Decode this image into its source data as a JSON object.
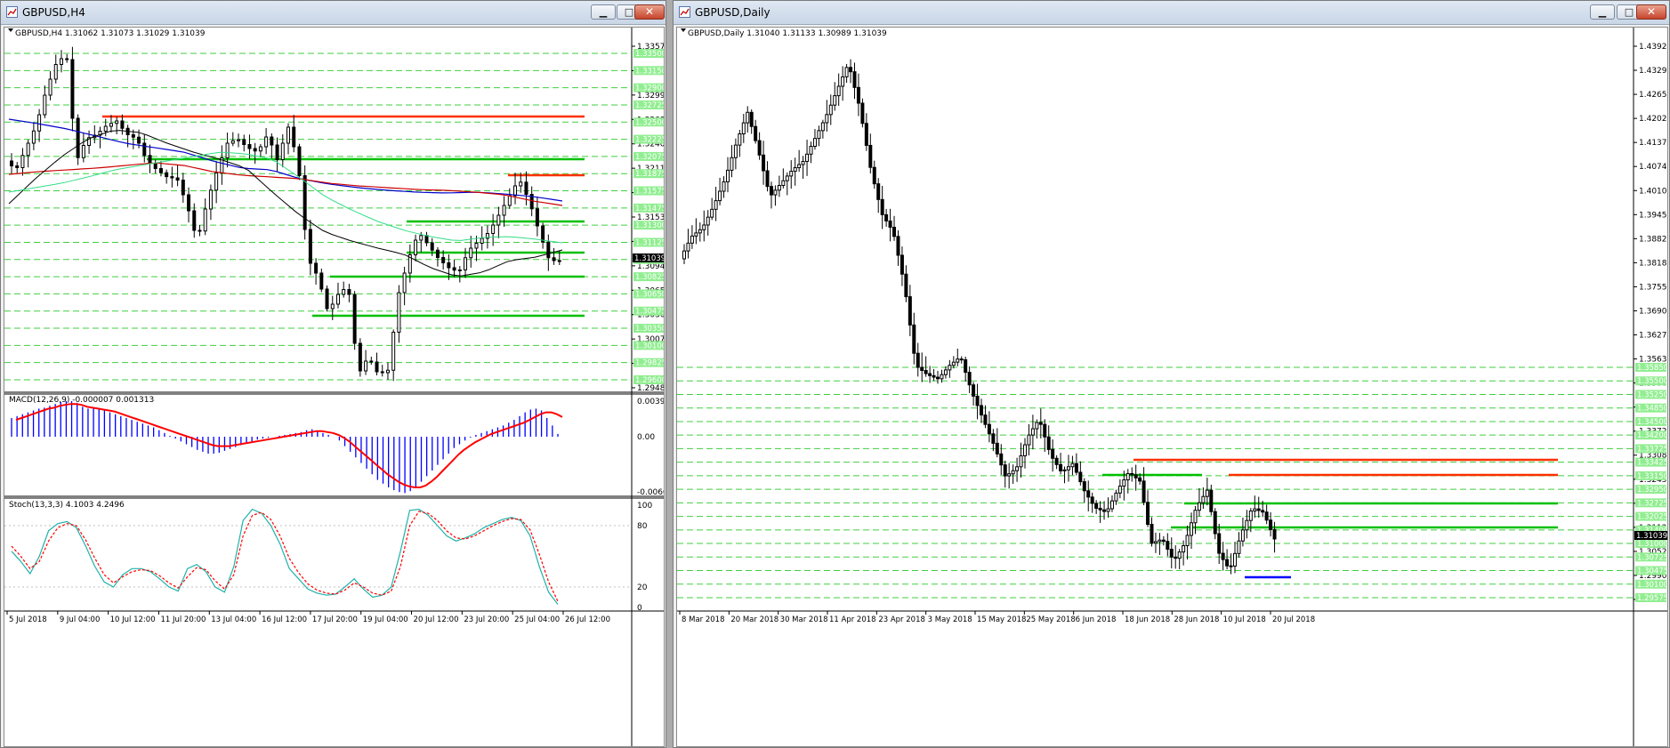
{
  "colors": {
    "bull": "#ffffff",
    "bear": "#000000",
    "resistance": "#ff3000",
    "support": "#00c000",
    "level_label_bg": "#90ee90",
    "grid": "#00c000",
    "ma_blue": "#0000cc",
    "ma_red": "#cc0000",
    "ma_black": "#000000",
    "ma_green": "#33dd88",
    "macd_hist": "#0000ff",
    "macd_signal": "#ff0000",
    "stoch_main": "#20b2aa",
    "stoch_signal": "#ff0000",
    "blue_level": "#0000ff"
  },
  "windows": [
    {
      "id": "h4",
      "title": "GBPUSD,H4",
      "icon": "chart-window-icon",
      "info": "GBPUSD,H4  1.31062 1.31073 1.31029 1.31039",
      "price_axis": [
        "1.33575",
        "1.33285",
        "1.32990",
        "1.32695",
        "1.32405",
        "1.32115",
        "1.31820",
        "1.31530",
        "1.31235",
        "1.30945",
        "1.30655",
        "1.30360",
        "1.30070",
        "1.29775",
        "1.29480"
      ],
      "current_price": "1.31039",
      "level_labels": [
        "1.33500",
        "1.33150",
        "1.32900",
        "1.32725",
        "1.32500",
        "1.32225",
        "1.32075",
        "1.31875",
        "1.31575",
        "1.31475",
        "1.31300",
        "1.31125",
        "1.30950",
        "1.30825",
        "1.30650",
        "1.30475",
        "1.30350",
        "1.30100",
        "1.29825",
        "1.29600"
      ],
      "macd": {
        "label": "MACD(12,26,9) -0.000007 0.001313",
        "axis": [
          "0.003989",
          "0.00",
          "-0.006067"
        ],
        "chart_data": {
          "type": "bar",
          "series": [
            {
              "values": [
                0.002,
                0.0022,
                0.0024,
                0.0026,
                0.0028,
                0.003,
                0.0031,
                0.0033,
                0.0035,
                0.0037,
                0.0038,
                0.0038,
                0.0036,
                0.0032,
                0.003,
                0.003,
                0.0029,
                0.0028,
                0.0026,
                0.0024,
                0.0022,
                0.002,
                0.0018,
                0.0016,
                0.0014,
                0.0012,
                0.001,
                0.0007,
                0.0004,
                0.0001,
                -0.0002,
                -0.0005,
                -0.0008,
                -0.0011,
                -0.0014,
                -0.0016,
                -0.0018,
                -0.0018,
                -0.0017,
                -0.0015,
                -0.0013,
                -0.0011,
                -0.0009,
                -0.0007,
                -0.0005,
                -0.0003,
                -0.0002,
                -0.0001,
                0.0,
                0.0001,
                0.0002,
                0.0003,
                0.0004,
                0.0005,
                0.0007,
                0.0008,
                0.0006,
                0.0004,
                0.0002,
                0.0,
                -0.0004,
                -0.001,
                -0.0016,
                -0.0022,
                -0.0028,
                -0.0034,
                -0.004,
                -0.0046,
                -0.005,
                -0.0054,
                -0.0057,
                -0.0059,
                -0.006,
                -0.0058,
                -0.0054,
                -0.0048,
                -0.0042,
                -0.0036,
                -0.003,
                -0.0024,
                -0.0018,
                -0.0012,
                -0.0008,
                -0.0004,
                -0.0001,
                0.0002,
                0.0004,
                0.0006,
                0.0008,
                0.001,
                0.0012,
                0.0015,
                0.0018,
                0.0022,
                0.0026,
                0.0029,
                0.003,
                0.0028,
                0.002,
                0.0012,
                0.0003
              ]
            },
            {
              "values": [
                0.0018,
                0.002,
                0.0022,
                0.0024,
                0.0026,
                0.0028,
                0.003,
                0.0031,
                0.0033,
                0.0034,
                0.0035,
                0.0035,
                0.0034,
                0.0032,
                0.0031,
                0.003,
                0.0029,
                0.0028,
                0.0027,
                0.0025,
                0.0023,
                0.0021,
                0.0019,
                0.0017,
                0.0015,
                0.0013,
                0.0011,
                0.0009,
                0.0007,
                0.0005,
                0.0003,
                0.0001,
                -0.0001,
                -0.0003,
                -0.0005,
                -0.0007,
                -0.0009,
                -0.001,
                -0.001,
                -0.001,
                -0.0009,
                -0.0008,
                -0.0007,
                -0.0006,
                -0.0005,
                -0.0004,
                -0.0003,
                -0.0002,
                -0.0001,
                0.0,
                0.0001,
                0.0002,
                0.0003,
                0.0004,
                0.0005,
                0.0006,
                0.0006,
                0.0005,
                0.0004,
                0.0002,
                -0.0001,
                -0.0005,
                -0.001,
                -0.0015,
                -0.002,
                -0.0025,
                -0.003,
                -0.0035,
                -0.004,
                -0.0044,
                -0.0048,
                -0.0051,
                -0.0053,
                -0.0054,
                -0.0054,
                -0.0052,
                -0.0048,
                -0.0043,
                -0.0037,
                -0.0031,
                -0.0025,
                -0.0019,
                -0.0014,
                -0.001,
                -0.0006,
                -0.0003,
                0.0,
                0.0003,
                0.0005,
                0.0007,
                0.0009,
                0.0011,
                0.0013,
                0.0015,
                0.0018,
                0.0021,
                0.0024,
                0.0026,
                0.0026,
                0.0024,
                0.0021
              ]
            }
          ],
          "ylim": [
            -0.006067,
            0.003989
          ]
        }
      },
      "stoch": {
        "label": "Stoch(13,3,3) 4.1003 4.2496",
        "axis": [
          "100",
          "80",
          "20",
          "0"
        ],
        "chart_data": {
          "type": "line",
          "series": [
            {
              "values": [
                55,
                45,
                33,
                50,
                75,
                82,
                84,
                78,
                60,
                40,
                25,
                20,
                32,
                38,
                38,
                35,
                28,
                20,
                16,
                38,
                42,
                35,
                20,
                15,
                40,
                85,
                96,
                92,
                80,
                62,
                38,
                28,
                18,
                14,
                12,
                13,
                20,
                28,
                18,
                10,
                12,
                20,
                55,
                95,
                96,
                90,
                80,
                70,
                65,
                68,
                72,
                78,
                82,
                86,
                88,
                85,
                70,
                40,
                15,
                3
              ]
            },
            {
              "values": [
                60,
                50,
                38,
                45,
                65,
                78,
                82,
                80,
                66,
                48,
                32,
                24,
                30,
                35,
                37,
                36,
                31,
                24,
                19,
                30,
                39,
                37,
                26,
                18,
                32,
                70,
                90,
                93,
                86,
                70,
                48,
                34,
                23,
                17,
                14,
                13,
                17,
                24,
                20,
                14,
                12,
                16,
                40,
                80,
                94,
                92,
                85,
                75,
                68,
                67,
                70,
                75,
                80,
                84,
                87,
                86,
                76,
                52,
                25,
                6
              ]
            }
          ],
          "ylim": [
            0,
            100
          ]
        }
      },
      "time_axis": [
        "5 Jul 2018",
        "9 Jul 04:00",
        "10 Jul 12:00",
        "11 Jul 20:00",
        "13 Jul 04:00",
        "16 Jul 12:00",
        "17 Jul 20:00",
        "19 Jul 04:00",
        "20 Jul 12:00",
        "23 Jul 20:00",
        "25 Jul 04:00",
        "26 Jul 12:00"
      ]
    },
    {
      "id": "daily",
      "title": "GBPUSD,Daily",
      "icon": "chart-window-icon",
      "info": "GBPUSD,Daily  1.31040 1.31133 1.30989 1.31039",
      "price_axis": [
        "1.43925",
        "1.43295",
        "1.42650",
        "1.42020",
        "1.41375",
        "1.40745",
        "1.40100",
        "1.39455",
        "1.38825",
        "1.38180",
        "1.37550",
        "1.36905",
        "1.36275",
        "1.35630",
        "1.35000",
        "1.34355",
        "1.33725",
        "1.33080",
        "1.32450",
        "1.31800",
        "1.31125",
        "1.30520",
        "1.29900",
        "1.29255"
      ],
      "current_price": "1.31039",
      "level_labels": [
        "1.35850",
        "1.35500",
        "1.35250",
        "1.34850",
        "1.34500",
        "1.34200",
        "1.33725",
        "1.33425",
        "1.33150",
        "1.32950",
        "1.32725",
        "1.32025",
        "1.31400",
        "1.31000",
        "1.30725",
        "1.30475",
        "1.30100",
        "1.29575"
      ],
      "time_axis": [
        "8 Mar 2018",
        "20 Mar 2018",
        "30 Mar 2018",
        "11 Apr 2018",
        "23 Apr 2018",
        "3 May 2018",
        "15 May 2018",
        "25 May 2018",
        "6 Jun 2018",
        "18 Jun 2018",
        "28 Jun 2018",
        "10 Jul 2018",
        "20 Jul 2018"
      ]
    }
  ]
}
